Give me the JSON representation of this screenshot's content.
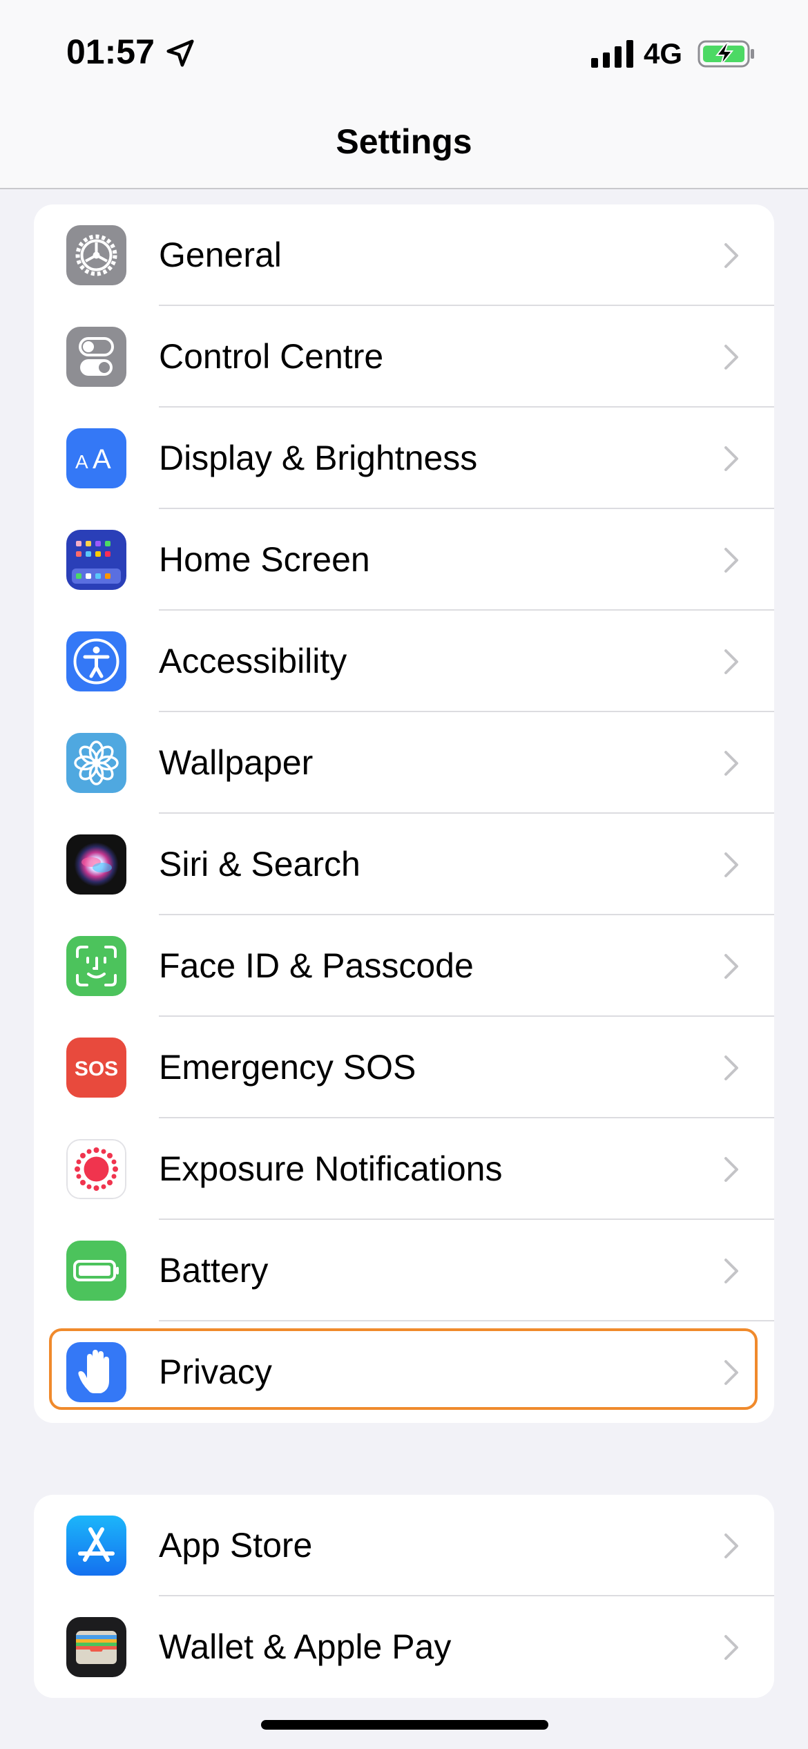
{
  "status_bar": {
    "time": "01:57",
    "network": "4G"
  },
  "nav": {
    "title": "Settings"
  },
  "colors": {
    "highlight": "#f08a2c",
    "background": "#f2f2f7"
  },
  "group1": [
    {
      "label": "General",
      "icon": "gear-icon"
    },
    {
      "label": "Control Centre",
      "icon": "toggles-icon"
    },
    {
      "label": "Display & Brightness",
      "icon": "text-size-icon"
    },
    {
      "label": "Home Screen",
      "icon": "app-grid-icon"
    },
    {
      "label": "Accessibility",
      "icon": "accessibility-icon"
    },
    {
      "label": "Wallpaper",
      "icon": "flower-icon"
    },
    {
      "label": "Siri & Search",
      "icon": "siri-icon"
    },
    {
      "label": "Face ID & Passcode",
      "icon": "face-id-icon"
    },
    {
      "label": "Emergency SOS",
      "icon": "sos-icon",
      "icon_text": "SOS"
    },
    {
      "label": "Exposure Notifications",
      "icon": "exposure-icon"
    },
    {
      "label": "Battery",
      "icon": "battery-icon"
    },
    {
      "label": "Privacy",
      "icon": "hand-icon",
      "highlighted": true
    }
  ],
  "group2": [
    {
      "label": "App Store",
      "icon": "app-store-icon"
    },
    {
      "label": "Wallet & Apple Pay",
      "icon": "wallet-icon"
    }
  ]
}
